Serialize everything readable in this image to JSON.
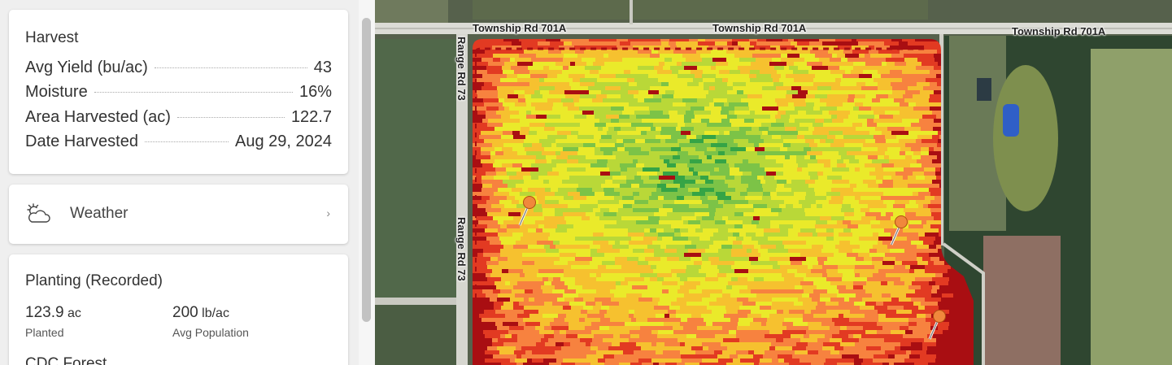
{
  "harvest": {
    "title": "Harvest",
    "stats": [
      {
        "label": "Avg Yield (bu/ac)",
        "value": "43"
      },
      {
        "label": "Moisture",
        "value": "16%"
      },
      {
        "label": "Area Harvested (ac)",
        "value": "122.7"
      },
      {
        "label": "Date Harvested",
        "value": "Aug 29, 2024"
      }
    ]
  },
  "weather": {
    "label": "Weather",
    "icon": "partly-cloudy-icon",
    "chevron": "›"
  },
  "planting": {
    "title": "Planting (Recorded)",
    "planted": {
      "value": "123.9",
      "unit": "ac",
      "label": "Planted"
    },
    "population": {
      "value": "200",
      "unit": "lb/ac",
      "label": "Avg Population"
    },
    "crop": "CDC Forest"
  },
  "map": {
    "roads": {
      "township_left": "Township Rd 701A",
      "township_mid": "Township Rd 701A",
      "township_right": "Township Rd 701A",
      "range_top": "Range Rd 73",
      "range_bottom": "Range Rd 73"
    },
    "yield_colors": [
      "#a90e12",
      "#e23a22",
      "#f7823f",
      "#f6c12f",
      "#eaea2a",
      "#b9d838",
      "#7cc347",
      "#35a446"
    ]
  }
}
